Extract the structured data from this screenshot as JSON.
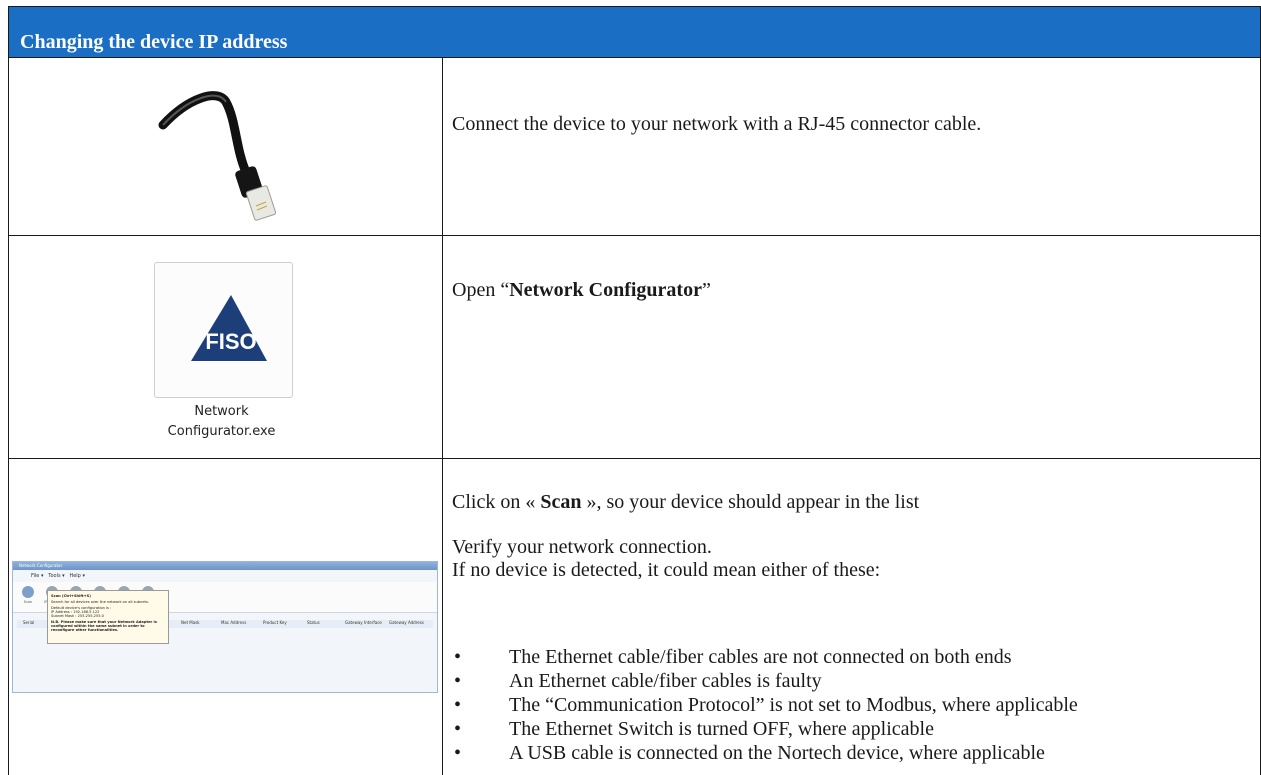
{
  "header": {
    "title": "Changing the device IP address"
  },
  "rows": [
    {
      "text": "Connect the device to your network with a RJ-45 connector cable."
    },
    {
      "text_prefix": "Open “",
      "text_bold": "Network Configurator",
      "text_suffix": "”",
      "icon_label_line1": "Network",
      "icon_label_line2": "Configurator.exe",
      "logo_text": "FISO"
    },
    {
      "line1_prefix": "Click on « ",
      "line1_bold": "Scan",
      "line1_suffix": " », so your device should appear in the list",
      "line2": "Verify your network connection.",
      "line3": "If no device is detected, it could mean either of these:",
      "bullets": [
        "The Ethernet cable/fiber cables are not connected on both ends",
        "An Ethernet cable/fiber cables is faulty",
        "The “Communication Protocol” is not set to Modbus, where applicable",
        "The Ethernet Switch is turned OFF, where applicable",
        "A USB cable is connected on the Nortech device, where applicable"
      ]
    }
  ],
  "mini_app": {
    "window_title": "Network Configurator",
    "menu": [
      "File",
      "Tools",
      "Help"
    ],
    "tools": [
      "Scan",
      "IP Config",
      "Date & Time",
      "Download",
      "Reboot",
      "Information"
    ],
    "columns": [
      "Serial",
      "Address",
      "Net Mask",
      "Mac Address",
      "Product Key",
      "Status",
      "Gateway Interface",
      "Gateway Address"
    ],
    "tooltip_title": "Scan (Ctrl+Shift+S)",
    "tooltip_lines": [
      "Search for all devices over the network on all subnets.",
      "Default device's configuration is :",
      "IP Address : 192.168.5.122",
      "Subnet Mask : 255.255.255.0",
      "N.B. Please make sure that your Network Adapter is configured within the same subnet in order to reconfigure other functionalities."
    ]
  },
  "colors": {
    "header_bg": "#1a6fc4",
    "header_text": "#ffffff",
    "logo_blue": "#1c3f7a"
  }
}
